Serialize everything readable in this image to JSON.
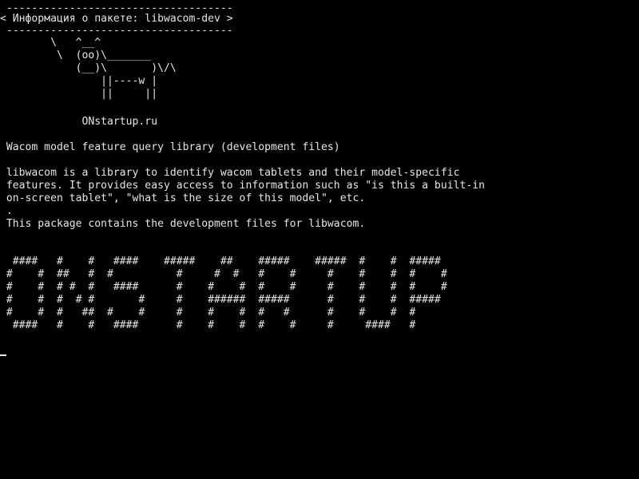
{
  "colors": {
    "background": "#000000",
    "foreground": "#e6e6e6"
  },
  "terminal": {
    "bubble": {
      "top_border": " ------------------------------------",
      "title": "< Информация о пакете: libwacom-dev >",
      "bottom_border": " ------------------------------------"
    },
    "cow": [
      "        \\   ^__^",
      "         \\  (oo)\\_______",
      "            (__)\\       )\\/\\",
      "                ||----w |",
      "                ||     ||"
    ],
    "site": "             ONstartup.ru",
    "summary": " Wacom model feature query library (development files)",
    "description": [
      " libwacom is a library to identify wacom tablets and their model-specific",
      " features. It provides easy access to information such as \"is this a built-in",
      " on-screen tablet\", \"what is the size of this model\", etc.",
      " .",
      " This package contains the development files for libwacom."
    ],
    "banner": [
      "  ####   #    #   ####    #####    ##    #####    #####  #    #  #####",
      " #    #  ##   #  #          #     #  #   #    #     #    #    #  #    #",
      " #    #  # #  #   ####      #    #    #  #    #     #    #    #  #    #",
      " #    #  #  # #       #     #    ######  #####      #    #    #  #####",
      " #    #  #   ##  #    #     #    #    #  #   #      #    #    #  #",
      "  ####   #    #   ####      #    #    #  #    #     #     ####   #"
    ]
  }
}
